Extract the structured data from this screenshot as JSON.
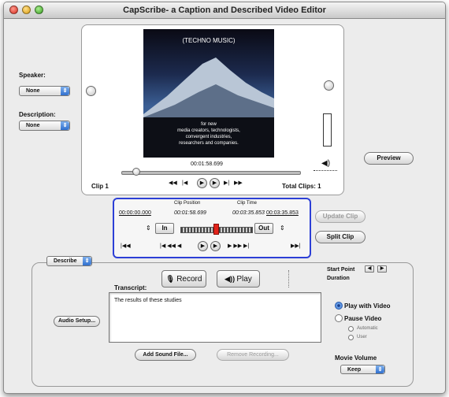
{
  "window": {
    "title": "CapScribe- a Caption and Described Video Editor"
  },
  "speaker": {
    "label": "Speaker:",
    "value": "None"
  },
  "description": {
    "label": "Description:",
    "value": "None"
  },
  "video": {
    "lines": [
      "(TECHNO MUSIC)",
      "for new",
      "media creators, technologists,",
      "convergent industries,",
      "researchers and companies."
    ],
    "time": "00:01:58.699",
    "clip_label": "Clip 1",
    "total_clips": "Total Clips: 1"
  },
  "preview_label": "Preview",
  "clip_editor": {
    "start_time": "00:00:00.000",
    "end_time": "00:03:35.853",
    "position_label": "Clip Position",
    "position_value": "00:01:58.699",
    "clip_time_label": "Clip Time",
    "clip_time_value": "00:03:35.853",
    "in_label": "In",
    "out_label": "Out"
  },
  "update_clip_label": "Update Clip",
  "split_clip_label": "Split Clip",
  "describe": {
    "mode": "Describe",
    "record_label": "Record",
    "play_label": "Play",
    "transcript_label": "Transcript:",
    "transcript_text": "The results of these studies",
    "audio_setup_label": "Audio Setup...",
    "add_sound_label": "Add Sound File...",
    "remove_recording_label": "Remove Recording...",
    "start_point_label": "Start Point",
    "duration_label": "Duration",
    "play_with_video_label": "Play with Video",
    "pause_video_label": "Pause Video",
    "automatic_label": "Automatic",
    "user_label": "User",
    "movie_volume_label": "Movie Volume",
    "movie_volume_value": "Keep"
  }
}
